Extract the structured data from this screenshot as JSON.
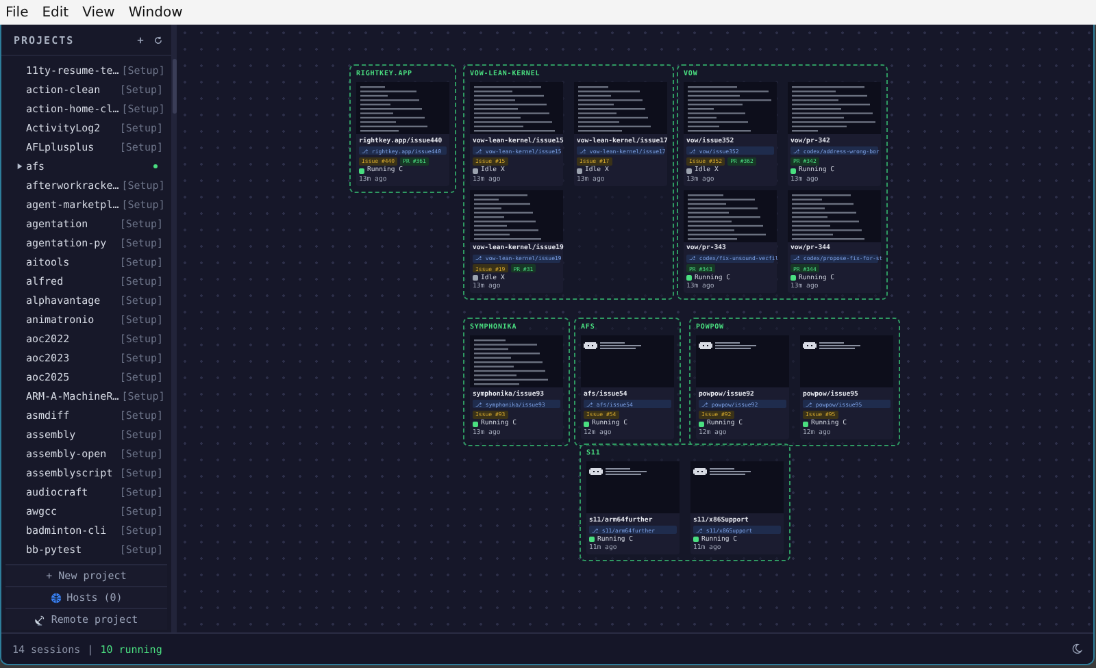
{
  "menu": [
    "File",
    "Edit",
    "View",
    "Window"
  ],
  "sidebar": {
    "title": "PROJECTS",
    "projects": [
      {
        "name": "11ty-resume-te…",
        "tag": "[Setup]",
        "expandable": false,
        "active": false
      },
      {
        "name": "action-clean",
        "tag": "[Setup]",
        "expandable": false,
        "active": false
      },
      {
        "name": "action-home-cl…",
        "tag": "[Setup]",
        "expandable": false,
        "active": false
      },
      {
        "name": "ActivityLog2",
        "tag": "[Setup]",
        "expandable": false,
        "active": false
      },
      {
        "name": "AFLplusplus",
        "tag": "[Setup]",
        "expandable": false,
        "active": false
      },
      {
        "name": "afs",
        "expandable": true,
        "active": true
      },
      {
        "name": "afterworkracke…",
        "tag": "[Setup]",
        "expandable": false,
        "active": false
      },
      {
        "name": "agent-marketpl…",
        "tag": "[Setup]",
        "expandable": false,
        "active": false
      },
      {
        "name": "agentation",
        "tag": "[Setup]",
        "expandable": false,
        "active": false
      },
      {
        "name": "agentation-py",
        "tag": "[Setup]",
        "expandable": false,
        "active": false
      },
      {
        "name": "aitools",
        "tag": "[Setup]",
        "expandable": false,
        "active": false
      },
      {
        "name": "alfred",
        "tag": "[Setup]",
        "expandable": false,
        "active": false
      },
      {
        "name": "alphavantage",
        "tag": "[Setup]",
        "expandable": false,
        "active": false
      },
      {
        "name": "animatronio",
        "tag": "[Setup]",
        "expandable": false,
        "active": false
      },
      {
        "name": "aoc2022",
        "tag": "[Setup]",
        "expandable": false,
        "active": false
      },
      {
        "name": "aoc2023",
        "tag": "[Setup]",
        "expandable": false,
        "active": false
      },
      {
        "name": "aoc2025",
        "tag": "[Setup]",
        "expandable": false,
        "active": false
      },
      {
        "name": "ARM-A-MachineR…",
        "tag": "[Setup]",
        "expandable": false,
        "active": false
      },
      {
        "name": "asmdiff",
        "tag": "[Setup]",
        "expandable": false,
        "active": false
      },
      {
        "name": "assembly",
        "tag": "[Setup]",
        "expandable": false,
        "active": false
      },
      {
        "name": "assembly-open",
        "tag": "[Setup]",
        "expandable": false,
        "active": false
      },
      {
        "name": "assemblyscript",
        "tag": "[Setup]",
        "expandable": false,
        "active": false
      },
      {
        "name": "audiocraft",
        "tag": "[Setup]",
        "expandable": false,
        "active": false
      },
      {
        "name": "awgcc",
        "tag": "[Setup]",
        "expandable": false,
        "active": false
      },
      {
        "name": "badminton-cli",
        "tag": "[Setup]",
        "expandable": false,
        "active": false
      },
      {
        "name": "bb-pytest",
        "tag": "[Setup]",
        "expandable": false,
        "active": false
      }
    ],
    "actions": [
      {
        "label": "+ New project",
        "kind": "plain"
      },
      {
        "label": "Hosts (0)",
        "kind": "globe"
      },
      {
        "label": "Remote project",
        "kind": "antenna"
      }
    ]
  },
  "groups": [
    {
      "title": "RIGHTKEY.APP",
      "sessions": [
        {
          "kind": "text",
          "name": "rightkey.app/issue440",
          "branch": "⎇ rightkey.app/issue440",
          "badges": [
            {
              "kind": "issue",
              "label": "Issue #440"
            },
            {
              "kind": "pr",
              "label": "PR #361"
            }
          ],
          "running": true,
          "status_label": "Running C",
          "time": "13m ago"
        }
      ]
    },
    {
      "title": "VOW-LEAN-KERNEL",
      "sessions": [
        {
          "kind": "text",
          "name": "vow-lean-kernel/issue15",
          "branch": "⎇ vow-lean-kernel/issue15",
          "badges": [
            {
              "kind": "issue",
              "label": "Issue #15"
            }
          ],
          "running": false,
          "status_label": "Idle X",
          "time": "13m ago"
        },
        {
          "kind": "text",
          "name": "vow-lean-kernel/issue17",
          "branch": "⎇ vow-lean-kernel/issue17",
          "badges": [
            {
              "kind": "issue",
              "label": "Issue #17"
            }
          ],
          "running": false,
          "status_label": "Idle X",
          "time": "13m ago"
        },
        {
          "kind": "text",
          "name": "vow-lean-kernel/issue19",
          "branch": "⎇ vow-lean-kernel/issue19",
          "badges": [
            {
              "kind": "issue",
              "label": "Issue #19"
            },
            {
              "kind": "pr",
              "label": "PR #31"
            }
          ],
          "running": false,
          "status_label": "Idle X",
          "time": "13m ago"
        }
      ]
    },
    {
      "title": "VOW",
      "sessions": [
        {
          "kind": "text",
          "name": "vow/issue352",
          "branch": "⎇ vow/issue352",
          "badges": [
            {
              "kind": "issue",
              "label": "Issue #352"
            },
            {
              "kind": "pr",
              "label": "PR #362"
            }
          ],
          "running": false,
          "status_label": "Idle X",
          "time": "13m ago"
        },
        {
          "kind": "text",
          "name": "vow/pr-342",
          "branch": "⎇ codex/address-wrong-bor",
          "badges": [
            {
              "kind": "pr",
              "label": "PR #342"
            }
          ],
          "running": true,
          "status_label": "Running C",
          "time": "13m ago"
        },
        {
          "kind": "text",
          "name": "vow/pr-343",
          "branch": "⎇ codex/fix-unsound-vecfil",
          "badges": [
            {
              "kind": "pr",
              "label": "PR #343"
            }
          ],
          "running": true,
          "status_label": "Running C",
          "time": "13m ago"
        },
        {
          "kind": "text",
          "name": "vow/pr-344",
          "branch": "⎇ codex/propose-fix-for-st",
          "badges": [
            {
              "kind": "pr",
              "label": "PR #344"
            }
          ],
          "running": true,
          "status_label": "Running C",
          "time": "13m ago"
        }
      ]
    },
    {
      "title": "SYMPHONIKA",
      "sessions": [
        {
          "kind": "text",
          "name": "symphonika/issue93",
          "branch": "⎇ symphonika/issue93",
          "badges": [
            {
              "kind": "issue",
              "label": "Issue #93"
            }
          ],
          "running": true,
          "status_label": "Running C",
          "time": "13m ago"
        }
      ]
    },
    {
      "title": "AFS",
      "sessions": [
        {
          "kind": "logo",
          "name": "afs/issue54",
          "branch": "⎇ afs/issue54",
          "badges": [
            {
              "kind": "issue",
              "label": "Issue #54"
            }
          ],
          "running": true,
          "status_label": "Running C",
          "time": "12m ago"
        }
      ]
    },
    {
      "title": "POWPOW",
      "sessions": [
        {
          "kind": "logo",
          "name": "powpow/issue92",
          "branch": "⎇ powpow/issue92",
          "badges": [
            {
              "kind": "issue",
              "label": "Issue #92"
            }
          ],
          "running": true,
          "status_label": "Running C",
          "time": "12m ago"
        },
        {
          "kind": "logo",
          "name": "powpow/issue95",
          "branch": "⎇ powpow/issue95",
          "badges": [
            {
              "kind": "issue",
              "label": "Issue #95"
            }
          ],
          "running": true,
          "status_label": "Running C",
          "time": "12m ago"
        }
      ]
    },
    {
      "title": "S11",
      "sessions": [
        {
          "kind": "logo",
          "name": "s11/arm64further",
          "branch": "⎇ s11/arm64further",
          "running": true,
          "status_label": "Running C",
          "time": "11m ago"
        },
        {
          "kind": "logo",
          "name": "s11/x86Support",
          "branch": "⎇ s11/x86Support",
          "running": true,
          "status_label": "Running C",
          "time": "11m ago"
        }
      ]
    }
  ],
  "status_bar": {
    "sessions": "14 sessions",
    "separator": "|",
    "running": "10 running"
  }
}
